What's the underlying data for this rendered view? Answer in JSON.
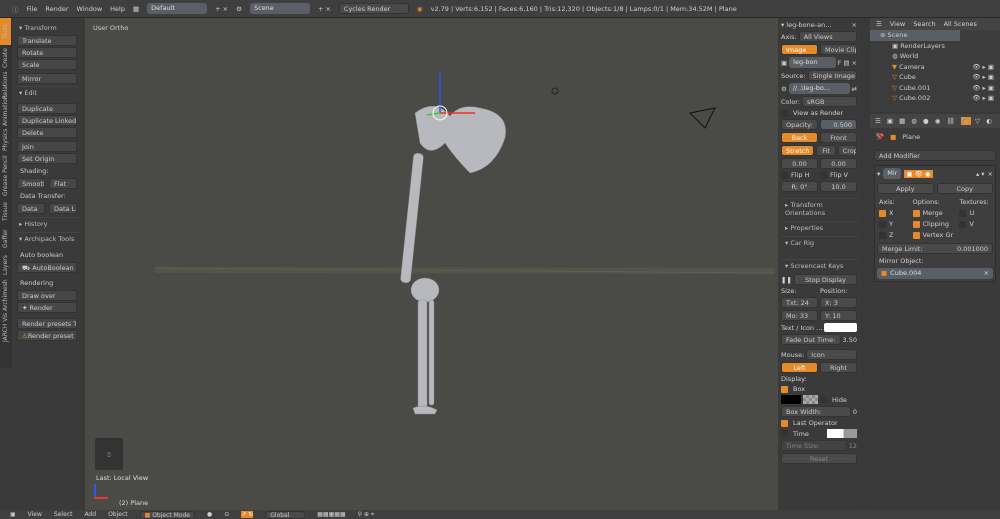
{
  "topbar": {
    "menus": [
      "File",
      "Render",
      "Window",
      "Help"
    ],
    "layout": "Default",
    "scene": "Scene",
    "engine": "Cycles Render",
    "stats": "v2.79 | Verts:6,152 | Faces:6,160 | Tris:12,320 | Objects:1/8 | Lamps:0/1 | Mem:34.52M | Plane"
  },
  "tabs": [
    "Tools",
    "Create",
    "Relations",
    "Animation",
    "Physics",
    "Grease Pencil",
    "Tissue",
    "Gaffer",
    "Layers",
    "Archimesh",
    "JARCH Vis"
  ],
  "tools": {
    "transform": "Transform",
    "translate": "Translate",
    "rotate": "Rotate",
    "scale": "Scale",
    "mirror": "Mirror",
    "edit": "Edit",
    "duplicate": "Duplicate",
    "duplicate_linked": "Duplicate Linked",
    "delete": "Delete",
    "join": "Join",
    "set_origin": "Set Origin",
    "shading": "Shading:",
    "smooth": "Smooth",
    "flat": "Flat",
    "data_transfer": "Data Transfer:",
    "data": "Data",
    "data_layo": "Data Layo",
    "history": "History",
    "archipack": "Archipack Tools",
    "auto_boolean_lbl": "Auto boolean",
    "autoboolean": "AutoBoolean",
    "rendering": "Rendering",
    "draw_over": "Draw over",
    "render": "Render",
    "render_presets": "Render presets Thu...",
    "render_preset_warn": "Render preset th..."
  },
  "viewport": {
    "view_label": "User Ortho",
    "last_op": "Last: Local View",
    "object": "(2) Plane"
  },
  "npanel": {
    "bg_title": "leg-bone-an...",
    "axis_lbl": "Axis:",
    "axis_val": "All Views",
    "image": "Image",
    "movie_clip": "Movie Clip",
    "img_name": "leg-bon",
    "img_f": "F",
    "source_lbl": "Source:",
    "source_val": "Single Image",
    "path": "//..\\leg-bo...",
    "color_lbl": "Color:",
    "color_val": "sRGB",
    "view_as_render": "View as Render",
    "opacity_lbl": "Opacity:",
    "opacity_val": "0.500",
    "back": "Back",
    "front": "Front",
    "stretch": "Stretch",
    "fit": "Fit",
    "crop": "Crop",
    "x_off": "0.00",
    "y_off": "0.00",
    "flip_h": "Flip H",
    "flip_v": "Flip V",
    "rot": "R: 0°",
    "size": "10.0",
    "transform_orient": "Transform Orientations",
    "properties": "Properties",
    "car_rig": "Car Rig",
    "screencast": "Screencast Keys",
    "stop_display": "Stop Display",
    "size_lbl": "Size:",
    "position_lbl": "Position:",
    "txt": "Txt: 24",
    "mo": "Mo: 33",
    "px": "X: 3",
    "py": "Y: 10",
    "text_icon": "Text / Icon ...",
    "fade_out": "Fade Out Time:",
    "fade_val": "3.50",
    "mouse_lbl": "Mouse:",
    "mouse_val": "Icon",
    "left": "Left",
    "right": "Right",
    "display_lbl": "Display:",
    "box": "Box",
    "hide": "Hide",
    "box_width": "Box Width:",
    "box_width_val": "0",
    "last_operator": "Last Operator",
    "time": "Time",
    "time_size": "Time Size:",
    "time_size_val": "12",
    "reset": "Reset"
  },
  "outliner": {
    "view": "View",
    "search": "Search",
    "all_scenes": "All Scenes",
    "items": [
      "Scene",
      "RenderLayers",
      "World",
      "Camera",
      "Cube",
      "Cube.001",
      "Cube.002"
    ]
  },
  "props": {
    "object": "Plane",
    "add_modifier": "Add Modifier",
    "mod_name": "Mir",
    "apply": "Apply",
    "copy": "Copy",
    "axis": "Axis:",
    "options": "Options:",
    "textures": "Textures:",
    "x": "X",
    "y": "Y",
    "z": "Z",
    "merge": "Merge",
    "clipping": "Clipping",
    "vertex_gr": "Vertex Gr",
    "u": "U",
    "v": "V",
    "merge_limit": "Merge Limit:",
    "merge_limit_val": "0.001000",
    "mirror_object": "Mirror Object:",
    "mirror_obj_val": "Cube.004"
  },
  "bottombar": {
    "items": [
      "View",
      "Select",
      "Add",
      "Object"
    ],
    "mode": "Object Mode",
    "pivot": "Global"
  }
}
